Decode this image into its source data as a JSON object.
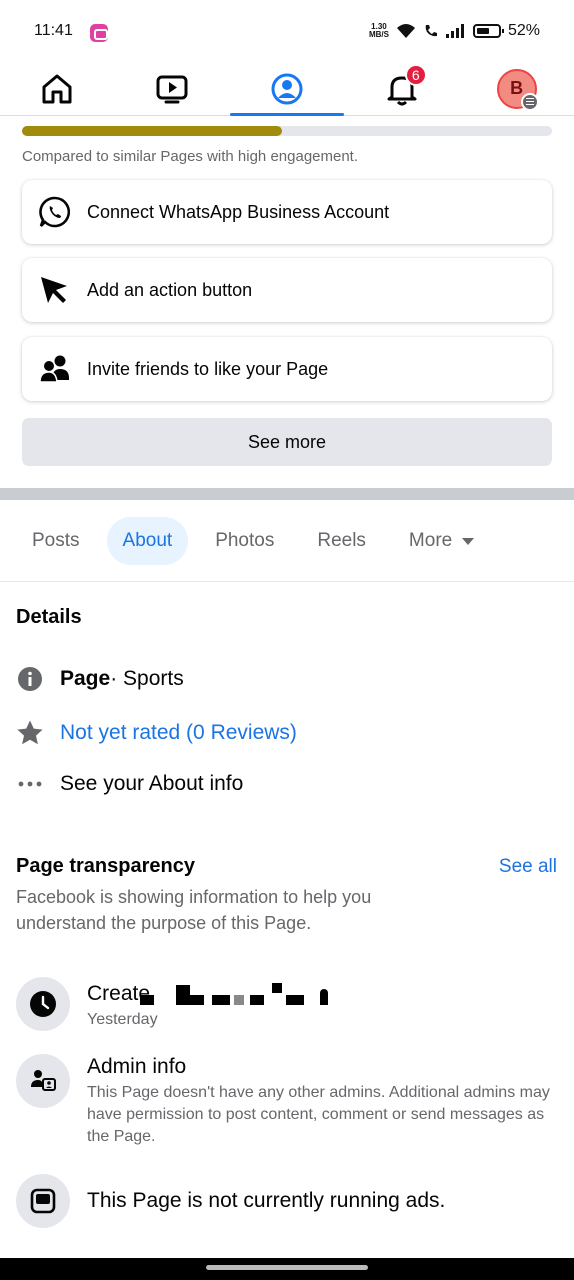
{
  "status_bar": {
    "time": "11:41",
    "net_speed_value": "1.30",
    "net_speed_unit": "MB/S",
    "battery": "52%"
  },
  "top_nav": {
    "tabs": [
      {
        "icon": "home-icon"
      },
      {
        "icon": "video-icon"
      },
      {
        "icon": "profile-icon",
        "active": true
      },
      {
        "icon": "bell-icon",
        "badge": "6"
      },
      {
        "icon": "avatar",
        "initial": "B"
      }
    ]
  },
  "engagement": {
    "progress_fraction": 0.49,
    "caption": "Compared to similar Pages with high engagement.",
    "progress_color": "#a18b0c"
  },
  "actions": {
    "items": [
      {
        "label": "Connect WhatsApp Business Account",
        "icon": "whatsapp-icon"
      },
      {
        "label": "Add an action button",
        "icon": "cursor-icon"
      },
      {
        "label": "Invite friends to like your Page",
        "icon": "people-icon"
      }
    ],
    "see_more_label": "See more"
  },
  "page_tabs": {
    "tabs": [
      "Posts",
      "About",
      "Photos",
      "Reels",
      "More"
    ],
    "active": "About"
  },
  "details": {
    "heading": "Details",
    "category_bold": "Page",
    "category_rest": " · Sports",
    "rating": "Not yet rated (0 Reviews)",
    "about_info": "See your About info"
  },
  "transparency": {
    "heading": "Page transparency",
    "see_all": "See all",
    "description": "Facebook is showing information to help you understand the purpose of this Page.",
    "created_label": "Create",
    "created_sub": "Yesterday",
    "admin_title": "Admin info",
    "admin_desc": "This Page doesn't have any other admins. Additional admins may have permission to post content, comment or send messages as the Page.",
    "ads_title": "This Page is not currently running ads."
  },
  "colors": {
    "accent": "#1877f2",
    "link": "#1b74e4",
    "badge": "#e41e3f"
  }
}
